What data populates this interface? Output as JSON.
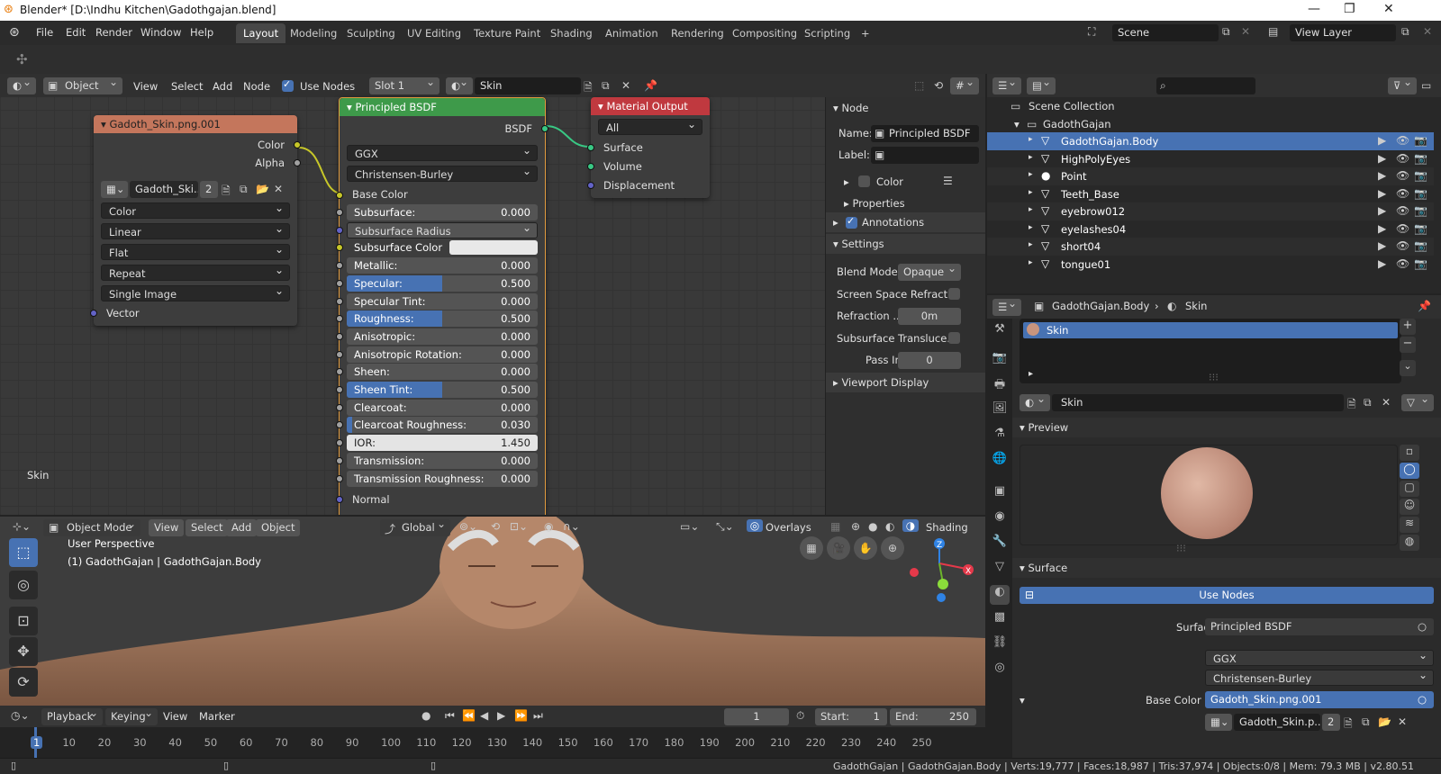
{
  "window": {
    "title": "Blender* [D:\\Indhu Kitchen\\Gadothgajan.blend]"
  },
  "menu": [
    "File",
    "Edit",
    "Render",
    "Window",
    "Help"
  ],
  "workspaces": [
    "Layout",
    "Modeling",
    "Sculpting",
    "UV Editing",
    "Texture Paint",
    "Shading",
    "Animation",
    "Rendering",
    "Compositing",
    "Scripting"
  ],
  "scene": {
    "label": "Scene",
    "view_layer": "View Layer"
  },
  "node_editor": {
    "object_mode": "Object",
    "view": "View",
    "select": "Select",
    "add": "Add",
    "node": "Node",
    "use_nodes": "Use Nodes",
    "slot": "Slot 1",
    "material": "Skin",
    "canvas_label": "Skin",
    "image_node": {
      "title": "Gadoth_Skin.png.001",
      "out_color": "Color",
      "out_alpha": "Alpha",
      "image_name": "Gadoth_Ski..",
      "users": "2",
      "color": "Color",
      "interp": "Linear",
      "proj": "Flat",
      "ext": "Repeat",
      "source": "Single Image",
      "vector": "Vector"
    },
    "bsdf_node": {
      "title": "Principled BSDF",
      "output": "BSDF",
      "distribution": "GGX",
      "sss_method": "Christensen-Burley",
      "base_color": "Base Color",
      "params": [
        {
          "label": "Subsurface:",
          "value": "0.000",
          "fill": 0
        },
        {
          "label": "Subsurface Radius",
          "value": "",
          "fill": 0
        },
        {
          "label": "Subsurface Color",
          "value": "",
          "fill": 0
        },
        {
          "label": "Metallic:",
          "value": "0.000",
          "fill": 0
        },
        {
          "label": "Specular:",
          "value": "0.500",
          "fill": 0.5
        },
        {
          "label": "Specular Tint:",
          "value": "0.000",
          "fill": 0
        },
        {
          "label": "Roughness:",
          "value": "0.500",
          "fill": 0.5
        },
        {
          "label": "Anisotropic:",
          "value": "0.000",
          "fill": 0
        },
        {
          "label": "Anisotropic Rotation:",
          "value": "0.000",
          "fill": 0
        },
        {
          "label": "Sheen:",
          "value": "0.000",
          "fill": 0
        },
        {
          "label": "Sheen Tint:",
          "value": "0.500",
          "fill": 0.5
        },
        {
          "label": "Clearcoat:",
          "value": "0.000",
          "fill": 0
        },
        {
          "label": "Clearcoat Roughness:",
          "value": "0.030",
          "fill": 0.03
        },
        {
          "label": "IOR:",
          "value": "1.450",
          "fill": 0
        },
        {
          "label": "Transmission:",
          "value": "0.000",
          "fill": 0
        },
        {
          "label": "Transmission Roughness:",
          "value": "0.000",
          "fill": 0
        }
      ],
      "normal": "Normal"
    },
    "output_node": {
      "title": "Material Output",
      "target": "All",
      "surface": "Surface",
      "volume": "Volume",
      "displacement": "Displacement"
    }
  },
  "node_panel": {
    "node_header": "Node",
    "name_label": "Name:",
    "name_value": "Principled BSDF",
    "label_label": "Label:",
    "color": "Color",
    "properties": "Properties",
    "annotations": "Annotations",
    "settings": "Settings",
    "blend_mode_label": "Blend Mode",
    "blend_mode": "Opaque",
    "ssr_label": "Screen Space Refract..",
    "refraction_label": "Refraction ..",
    "refraction_value": "0m",
    "sst_label": "Subsurface Transluce..",
    "pass_label": "Pass Index",
    "pass_value": "0",
    "viewport_display": "Viewport Display"
  },
  "outliner": {
    "scene_collection": "Scene Collection",
    "collection": "GadothGajan",
    "items": [
      "GadothGajan.Body",
      "HighPolyEyes",
      "Point",
      "Teeth_Base",
      "eyebrow012",
      "eyelashes04",
      "short04",
      "tongue01"
    ]
  },
  "properties": {
    "breadcrumb_obj": "GadothGajan.Body",
    "breadcrumb_mat": "Skin",
    "slot": "Skin",
    "material": "Skin",
    "preview": "Preview",
    "surface_header": "Surface",
    "use_nodes": "Use Nodes",
    "surface_label": "Surface",
    "surface_value": "Principled BSDF",
    "distribution": "GGX",
    "sss": "Christensen-Burley",
    "base_color_label": "Base Color",
    "base_color_value": "Gadoth_Skin.png.001",
    "image_name": "Gadoth_Skin.p..",
    "users": "2"
  },
  "viewport": {
    "mode": "Object Mode",
    "view": "View",
    "select": "Select",
    "add": "Add",
    "object": "Object",
    "orientation": "Global",
    "overlays": "Overlays",
    "shading": "Shading",
    "perspective": "User Perspective",
    "selection": "(1) GadothGajan | GadothGajan.Body"
  },
  "timeline": {
    "playback": "Playback",
    "keying": "Keying",
    "view": "View",
    "marker": "Marker",
    "current": "1",
    "start_label": "Start:",
    "start": "1",
    "end_label": "End:",
    "end": "250",
    "ticks": [
      "1",
      "10",
      "20",
      "30",
      "40",
      "50",
      "60",
      "70",
      "80",
      "90",
      "100",
      "110",
      "120",
      "130",
      "140",
      "150",
      "160",
      "170",
      "180",
      "190",
      "200",
      "210",
      "220",
      "230",
      "240",
      "250"
    ]
  },
  "status": "GadothGajan | GadothGajan.Body | Verts:19,777 | Faces:18,987 | Tris:37,974 | Objects:0/8 | Mem: 79.3 MB | v2.80.51"
}
